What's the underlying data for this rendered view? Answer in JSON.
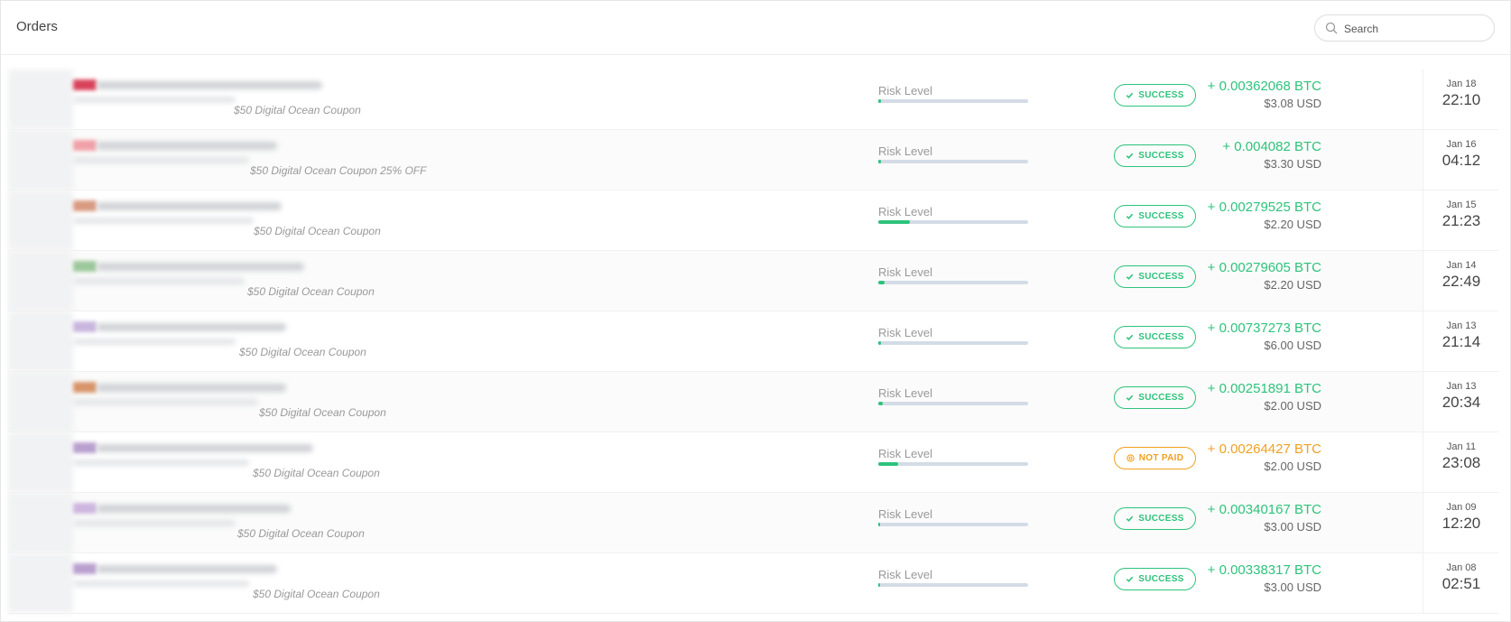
{
  "header": {
    "title": "Orders"
  },
  "search": {
    "placeholder": "Search"
  },
  "risk_label": "Risk Level",
  "colors": {
    "success": "#2ec37c",
    "warning": "#f0a020",
    "track": "#d3dce6"
  },
  "orders": [
    {
      "product": "$50 Digital Ocean Coupon",
      "risk": 0.02,
      "status": "SUCCESS",
      "status_icon": "check-icon",
      "btc": "+ 0.00362068 BTC",
      "usd": "$3.08 USD",
      "day": "Jan 18",
      "time": "22:10",
      "flag_color": "#d9425a"
    },
    {
      "product": "$50 Digital Ocean Coupon 25% OFF",
      "risk": 0.02,
      "status": "SUCCESS",
      "status_icon": "check-icon",
      "btc": "+ 0.004082 BTC",
      "usd": "$3.30 USD",
      "day": "Jan 16",
      "time": "04:12",
      "flag_color": "#f0a0a8"
    },
    {
      "product": "$50 Digital Ocean Coupon",
      "risk": 0.21,
      "status": "SUCCESS",
      "status_icon": "check-icon",
      "btc": "+ 0.00279525 BTC",
      "usd": "$2.20 USD",
      "day": "Jan 15",
      "time": "21:23",
      "flag_color": "#d89a80"
    },
    {
      "product": "$50 Digital Ocean Coupon",
      "risk": 0.04,
      "status": "SUCCESS",
      "status_icon": "check-icon",
      "btc": "+ 0.00279605 BTC",
      "usd": "$2.20 USD",
      "day": "Jan 14",
      "time": "22:49",
      "flag_color": "#9cc79a"
    },
    {
      "product": "$50 Digital Ocean Coupon",
      "risk": 0.02,
      "status": "SUCCESS",
      "status_icon": "check-icon",
      "btc": "+ 0.00737273 BTC",
      "usd": "$6.00 USD",
      "day": "Jan 13",
      "time": "21:14",
      "flag_color": "#c9b6df"
    },
    {
      "product": "$50 Digital Ocean Coupon",
      "risk": 0.03,
      "status": "SUCCESS",
      "status_icon": "check-icon",
      "btc": "+ 0.00251891 BTC",
      "usd": "$2.00 USD",
      "day": "Jan 13",
      "time": "20:34",
      "flag_color": "#d8946a"
    },
    {
      "product": "$50 Digital Ocean Coupon",
      "risk": 0.13,
      "status": "NOT PAID",
      "status_icon": "clock-icon",
      "btc": "+ 0.00264427 BTC",
      "usd": "$2.00 USD",
      "day": "Jan 11",
      "time": "23:08",
      "flag_color": "#b9a0cf"
    },
    {
      "product": "$50 Digital Ocean Coupon",
      "risk": 0.01,
      "status": "SUCCESS",
      "status_icon": "check-icon",
      "btc": "+ 0.00340167 BTC",
      "usd": "$3.00 USD",
      "day": "Jan 09",
      "time": "12:20",
      "flag_color": "#cdb6df"
    },
    {
      "product": "$50 Digital Ocean Coupon",
      "risk": 0.01,
      "status": "SUCCESS",
      "status_icon": "check-icon",
      "btc": "+ 0.00338317 BTC",
      "usd": "$3.00 USD",
      "day": "Jan 08",
      "time": "02:51",
      "flag_color": "#b9a0cf"
    }
  ]
}
